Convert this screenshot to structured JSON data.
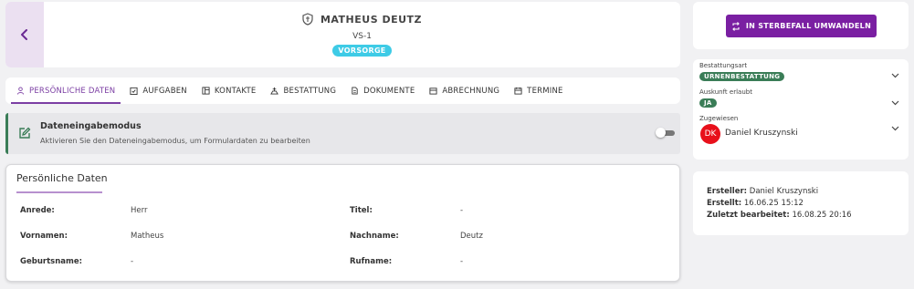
{
  "header": {
    "title": "MATHEUS DEUTZ",
    "subtitle": "VS-1",
    "badge": "VORSORGE"
  },
  "tabs": [
    {
      "label": "PERSÖNLICHE DATEN",
      "icon": "person-icon",
      "active": true
    },
    {
      "label": "AUFGABEN",
      "icon": "task-icon",
      "active": false
    },
    {
      "label": "KONTAKTE",
      "icon": "contacts-icon",
      "active": false
    },
    {
      "label": "BESTATTUNG",
      "icon": "burial-icon",
      "active": false
    },
    {
      "label": "DOKUMENTE",
      "icon": "document-icon",
      "active": false
    },
    {
      "label": "ABRECHNUNG",
      "icon": "billing-icon",
      "active": false
    },
    {
      "label": "TERMINE",
      "icon": "calendar-icon",
      "active": false
    }
  ],
  "data_entry_mode": {
    "title": "Dateneingabemodus",
    "description": "Aktivieren Sie den Dateneingabemodus, um Formulardaten zu bearbeiten",
    "enabled": false
  },
  "personal": {
    "title": "Persönliche Daten",
    "fields": {
      "anrede": {
        "label": "Anrede:",
        "value": "Herr"
      },
      "titel": {
        "label": "Titel:",
        "value": "-"
      },
      "vornamen": {
        "label": "Vornamen:",
        "value": "Matheus"
      },
      "nachname": {
        "label": "Nachname:",
        "value": "Deutz"
      },
      "geburtsname": {
        "label": "Geburtsname:",
        "value": "-"
      },
      "rufname": {
        "label": "Rufname:",
        "value": "-"
      }
    }
  },
  "action": {
    "convert_label": "IN STERBEFALL UMWANDELN"
  },
  "meta": {
    "bestattungsart_label": "Bestattungsart",
    "bestattungsart_value": "URNENBESTATTUNG",
    "auskunft_label": "Auskunft erlaubt",
    "auskunft_value": "JA",
    "zugewiesen_label": "Zugewiesen",
    "zugewiesen_initials": "DK",
    "zugewiesen_name": "Daniel Kruszynski"
  },
  "creator": {
    "ersteller_label": "Ersteller:",
    "ersteller_value": "Daniel Kruszynski",
    "erstellt_label": "Erstellt:",
    "erstellt_value": "16.06.25 15:12",
    "bearbeitet_label": "Zuletzt bearbeitet:",
    "bearbeitet_value": "16.08.25 20:16"
  },
  "colors": {
    "accent_purple": "#7a1fa2",
    "badge_cyan": "#3ecbe6",
    "pill_green": "#3a7d57",
    "avatar_red": "#e8101b"
  }
}
